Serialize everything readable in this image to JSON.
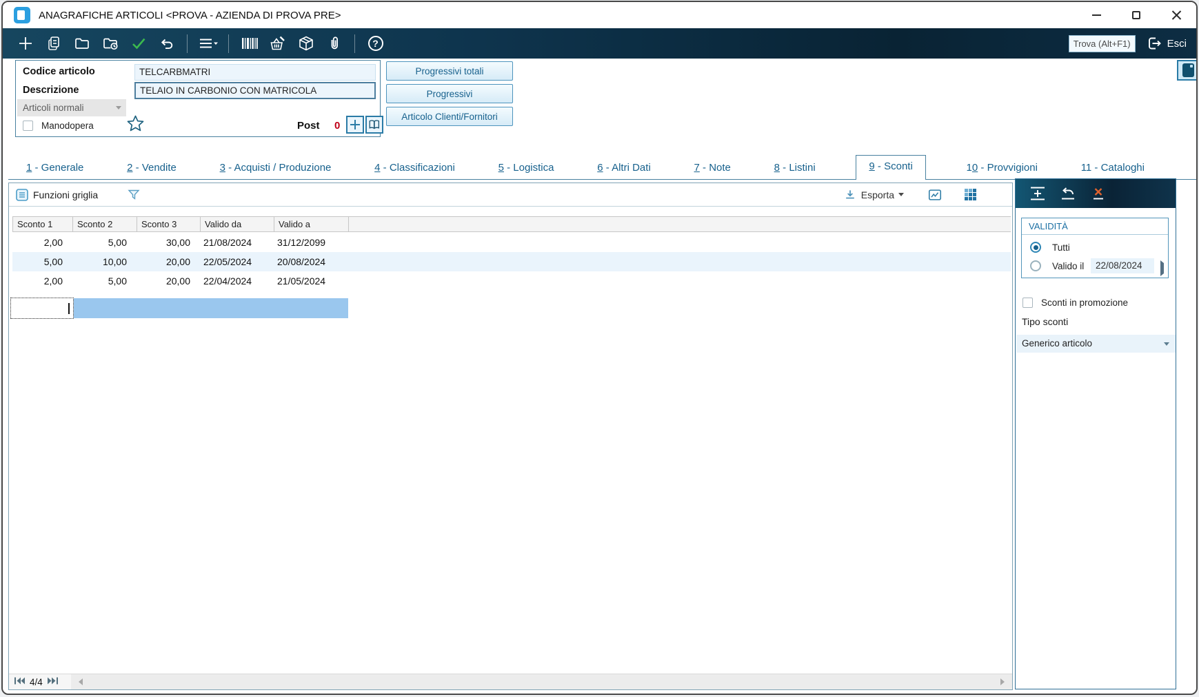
{
  "colors": {
    "accent": "#1b6fa3",
    "toolbar_navy": "#0e344d",
    "selection_blue": "#9ac7ee",
    "post_red": "#c00018",
    "check_green": "#3cb94e",
    "delete_orange": "#e0622d"
  },
  "titlebar": {
    "title": "ANAGRAFICHE ARTICOLI <PROVA - AZIENDA DI PROVA PRE>"
  },
  "toolbar": {
    "find_placeholder": "Trova (Alt+F1)",
    "exit_label": "Esci"
  },
  "form": {
    "codice_label": "Codice articolo",
    "codice_value": "TELCARBMATRI",
    "descrizione_label": "Descrizione",
    "descrizione_value": "TELAIO IN CARBONIO CON MATRICOLA",
    "categoria_value": "Articoli normali",
    "manodopera_label": "Manodopera",
    "post_label": "Post",
    "post_value": "0"
  },
  "quick_buttons": {
    "progressivi_totali": "Progressivi totali",
    "progressivi": "Progressivi",
    "articolo_clienti_fornitori": "Articolo Clienti/Fornitori"
  },
  "tabs": [
    {
      "pre": "",
      "num": "1",
      "rest": " - Generale"
    },
    {
      "pre": "",
      "num": "2",
      "rest": " - Vendite"
    },
    {
      "pre": "",
      "num": "3",
      "rest": " - Acquisti / Produzione"
    },
    {
      "pre": "",
      "num": "4",
      "rest": " - Classificazioni"
    },
    {
      "pre": "",
      "num": "5",
      "rest": " - Logistica"
    },
    {
      "pre": "",
      "num": "6",
      "rest": " - Altri Dati"
    },
    {
      "pre": "",
      "num": "7",
      "rest": " - Note"
    },
    {
      "pre": "",
      "num": "8",
      "rest": " - Listini"
    },
    {
      "pre": "",
      "num": "9",
      "rest": " - Sconti"
    },
    {
      "pre": "1",
      "num": "0",
      "rest": " - Provvigioni"
    },
    {
      "pre": "11",
      "num": "",
      "rest": " - Cataloghi"
    }
  ],
  "active_tab": "9 - Sconti",
  "grid_toolbar": {
    "funzioni_label": "Funzioni griglia",
    "esporta_label": "Esporta"
  },
  "grid": {
    "columns": [
      "Sconto 1",
      "Sconto 2",
      "Sconto 3",
      "Valido da",
      "Valido a"
    ],
    "rows": [
      [
        "2,00",
        "5,00",
        "30,00",
        "21/08/2024",
        "31/12/2099"
      ],
      [
        "5,00",
        "10,00",
        "20,00",
        "22/05/2024",
        "20/08/2024"
      ],
      [
        "2,00",
        "5,00",
        "20,00",
        "22/04/2024",
        "21/05/2024"
      ]
    ]
  },
  "panel": {
    "validita_title": "VALIDITÀ",
    "radio_tutti_label": "Tutti",
    "radio_valido_label": "Valido il",
    "valido_il_date": "22/08/2024",
    "promo_label": "Sconti in promozione",
    "tipo_sconti_label": "Tipo sconti",
    "tipo_sconti_value": "Generico articolo"
  },
  "statusbar": {
    "record_position": "4/4"
  }
}
